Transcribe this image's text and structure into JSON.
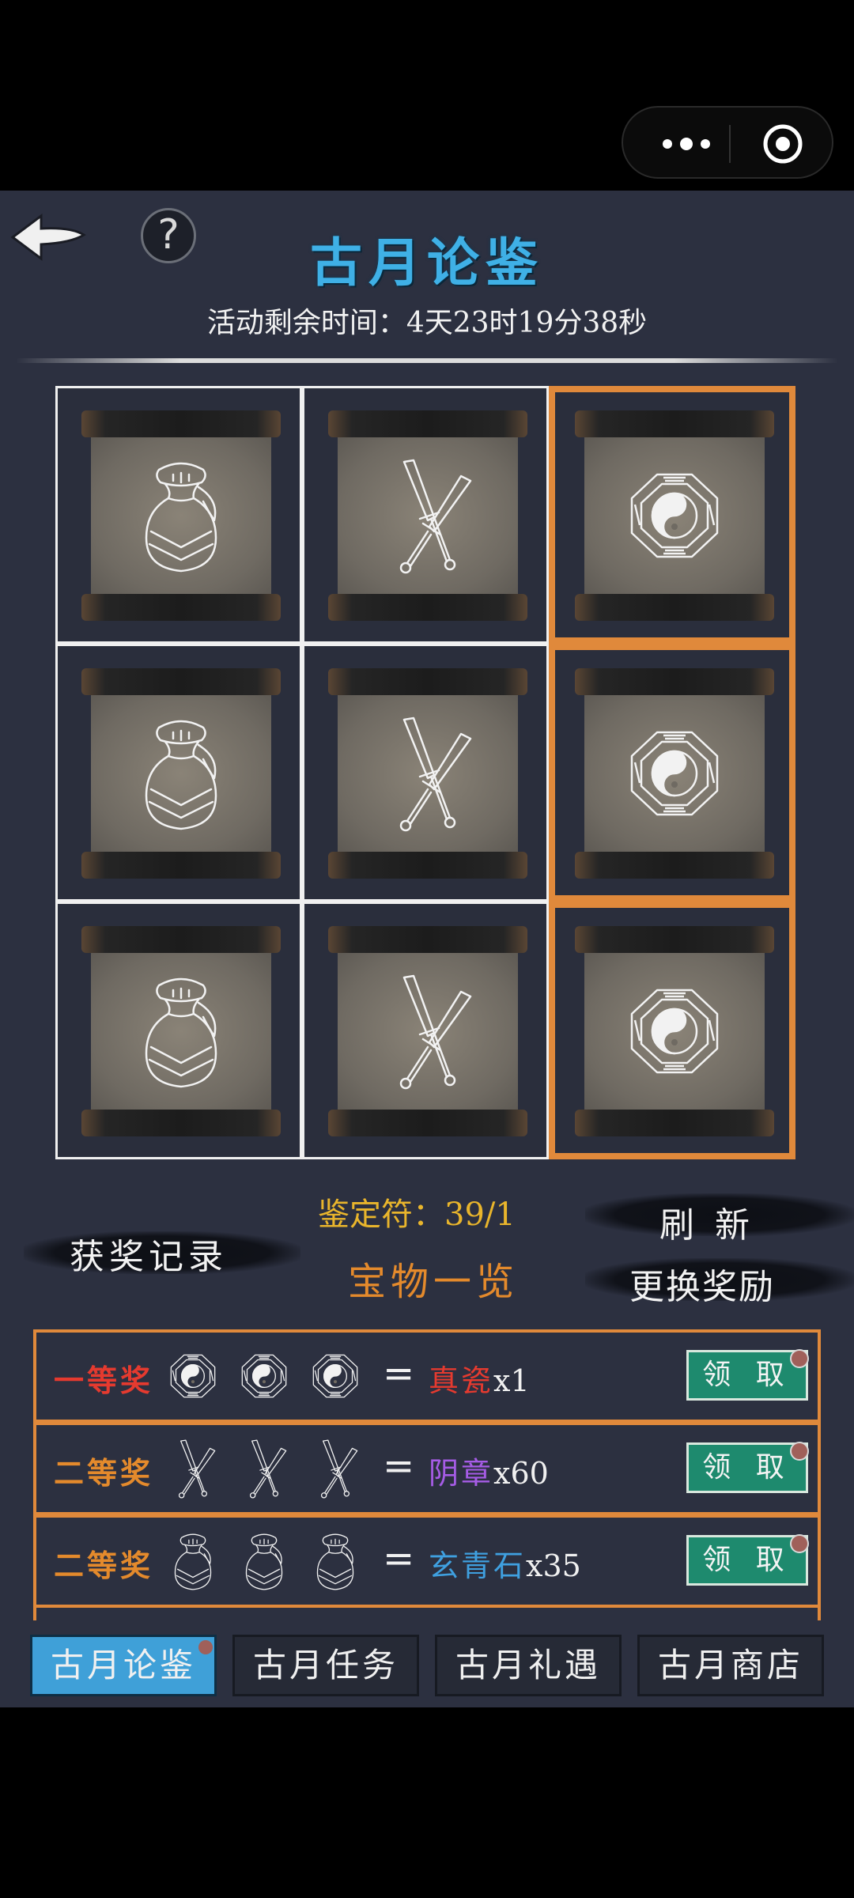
{
  "colors": {
    "title": "#3fb0e6",
    "accent_orange": "#e0893b",
    "gold": "#e9b52c",
    "first_prize": "#e53a2f",
    "second_prize": "#e48a2c",
    "purple": "#a65ce6",
    "blue": "#3fa0e0",
    "claim_bg": "#1e8a6e"
  },
  "header": {
    "back_icon": "back-arrow-icon",
    "help_icon": "question-icon",
    "title": "古月论鉴",
    "timer": "活动剩余时间：4天23时19分38秒"
  },
  "grid": {
    "rows": [
      {
        "cells": [
          {
            "icon": "pouch-icon",
            "highlighted": false
          },
          {
            "icon": "crossed-swords-icon",
            "highlighted": false
          },
          {
            "icon": "bagua-icon",
            "highlighted": true
          }
        ]
      },
      {
        "cells": [
          {
            "icon": "pouch-icon",
            "highlighted": false
          },
          {
            "icon": "crossed-swords-icon",
            "highlighted": false
          },
          {
            "icon": "bagua-icon",
            "highlighted": true
          }
        ]
      },
      {
        "cells": [
          {
            "icon": "pouch-icon",
            "highlighted": false
          },
          {
            "icon": "crossed-swords-icon",
            "highlighted": false
          },
          {
            "icon": "bagua-icon",
            "highlighted": true
          }
        ]
      }
    ]
  },
  "controls": {
    "appraisal_tokens": "鉴定符：39/1",
    "refresh": "刷 新",
    "records": "获奖记录",
    "treasure_list": "宝物一览",
    "change_reward": "更换奖励"
  },
  "prizes": [
    {
      "name": "一等奖",
      "icon": "bagua-icon",
      "reward_name": "真瓷",
      "reward_count": "x1",
      "claim": "领 取"
    },
    {
      "name": "二等奖",
      "icon": "crossed-swords-icon",
      "reward_name": "阴章",
      "reward_count": "x60",
      "claim": "领 取"
    },
    {
      "name": "二等奖",
      "icon": "pouch-icon",
      "reward_name": "玄青石",
      "reward_count": "x35",
      "claim": "领 取"
    }
  ],
  "tabs": [
    {
      "label": "古月论鉴",
      "active": true
    },
    {
      "label": "古月任务",
      "active": false
    },
    {
      "label": "古月礼遇",
      "active": false
    },
    {
      "label": "古月商店",
      "active": false
    }
  ]
}
